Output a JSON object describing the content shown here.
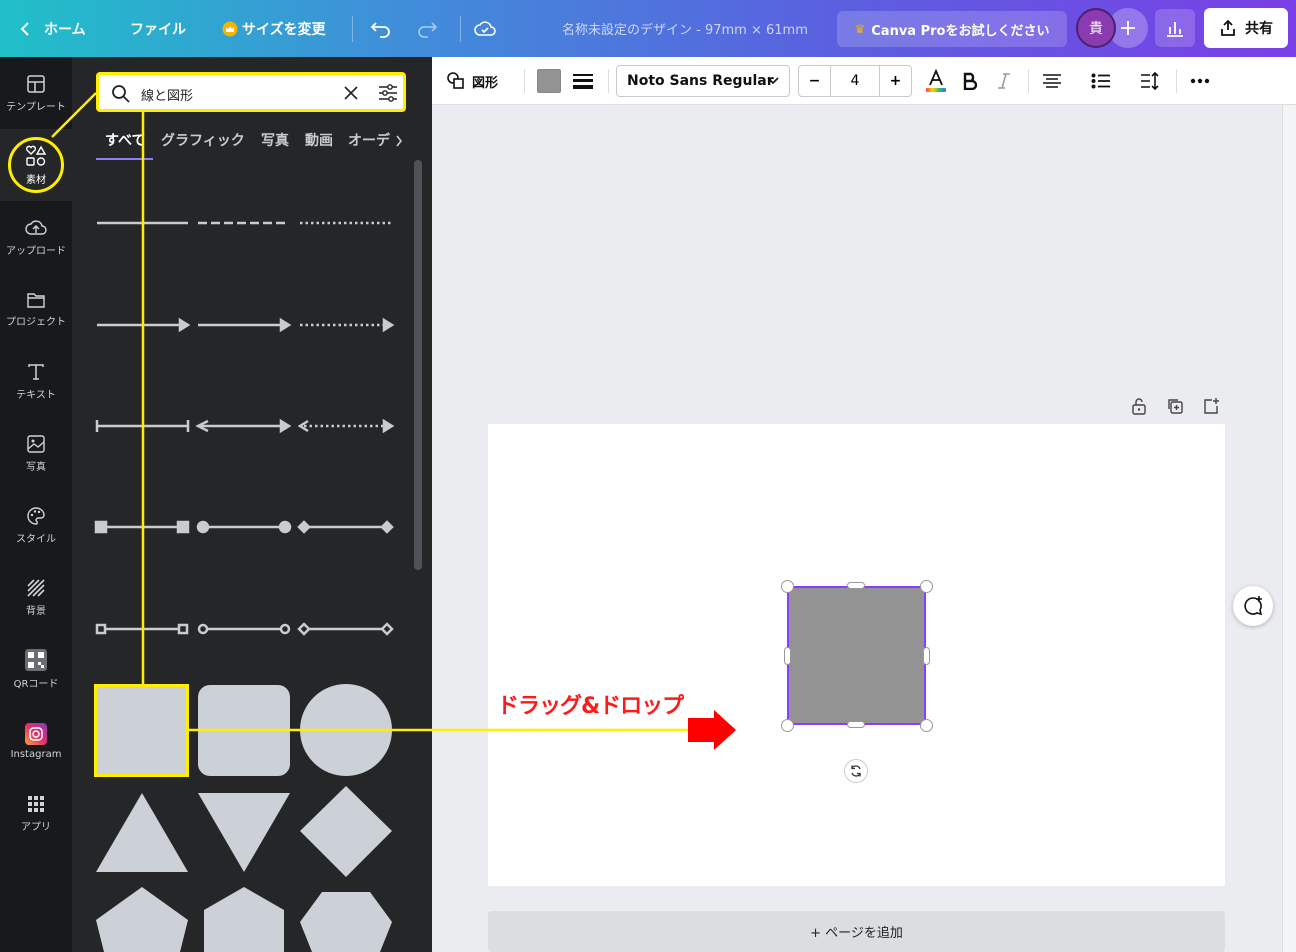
{
  "topbar": {
    "home_label": "ホーム",
    "file_label": "ファイル",
    "resize_label": "サイズを変更",
    "design_title": "名称未設定のデザイン - 97mm × 61mm",
    "pro_label": "Canva Proをお試しください",
    "avatar_initial": "貴",
    "share_label": "共有"
  },
  "rail": {
    "items": [
      {
        "label": "テンプレート",
        "icon": "template-icon"
      },
      {
        "label": "素材",
        "icon": "elements-icon"
      },
      {
        "label": "アップロード",
        "icon": "upload-icon"
      },
      {
        "label": "プロジェクト",
        "icon": "folder-icon"
      },
      {
        "label": "テキスト",
        "icon": "text-icon"
      },
      {
        "label": "写真",
        "icon": "photo-icon"
      },
      {
        "label": "スタイル",
        "icon": "palette-icon"
      },
      {
        "label": "背景",
        "icon": "background-icon"
      },
      {
        "label": "QRコード",
        "icon": "qr-icon"
      },
      {
        "label": "Instagram",
        "icon": "instagram-icon"
      },
      {
        "label": "アプリ",
        "icon": "apps-icon"
      }
    ]
  },
  "panel": {
    "search_value": "線と図形",
    "tabs": [
      "すべて",
      "グラフィック",
      "写真",
      "動画",
      "オーデ"
    ]
  },
  "toolbar": {
    "shape_label": "図形",
    "fill_color": "#939393",
    "font_name": "Noto Sans Regular",
    "font_size": "4",
    "minus": "−",
    "plus": "+"
  },
  "canvas": {
    "add_page_label": "+ ページを追加",
    "shape_color": "#939393",
    "selection_color": "#8b3dff"
  },
  "annotation": {
    "label": "ドラッグ&ドロップ",
    "highlight_color": "#ffee00",
    "arrow_color": "#ff0000"
  }
}
